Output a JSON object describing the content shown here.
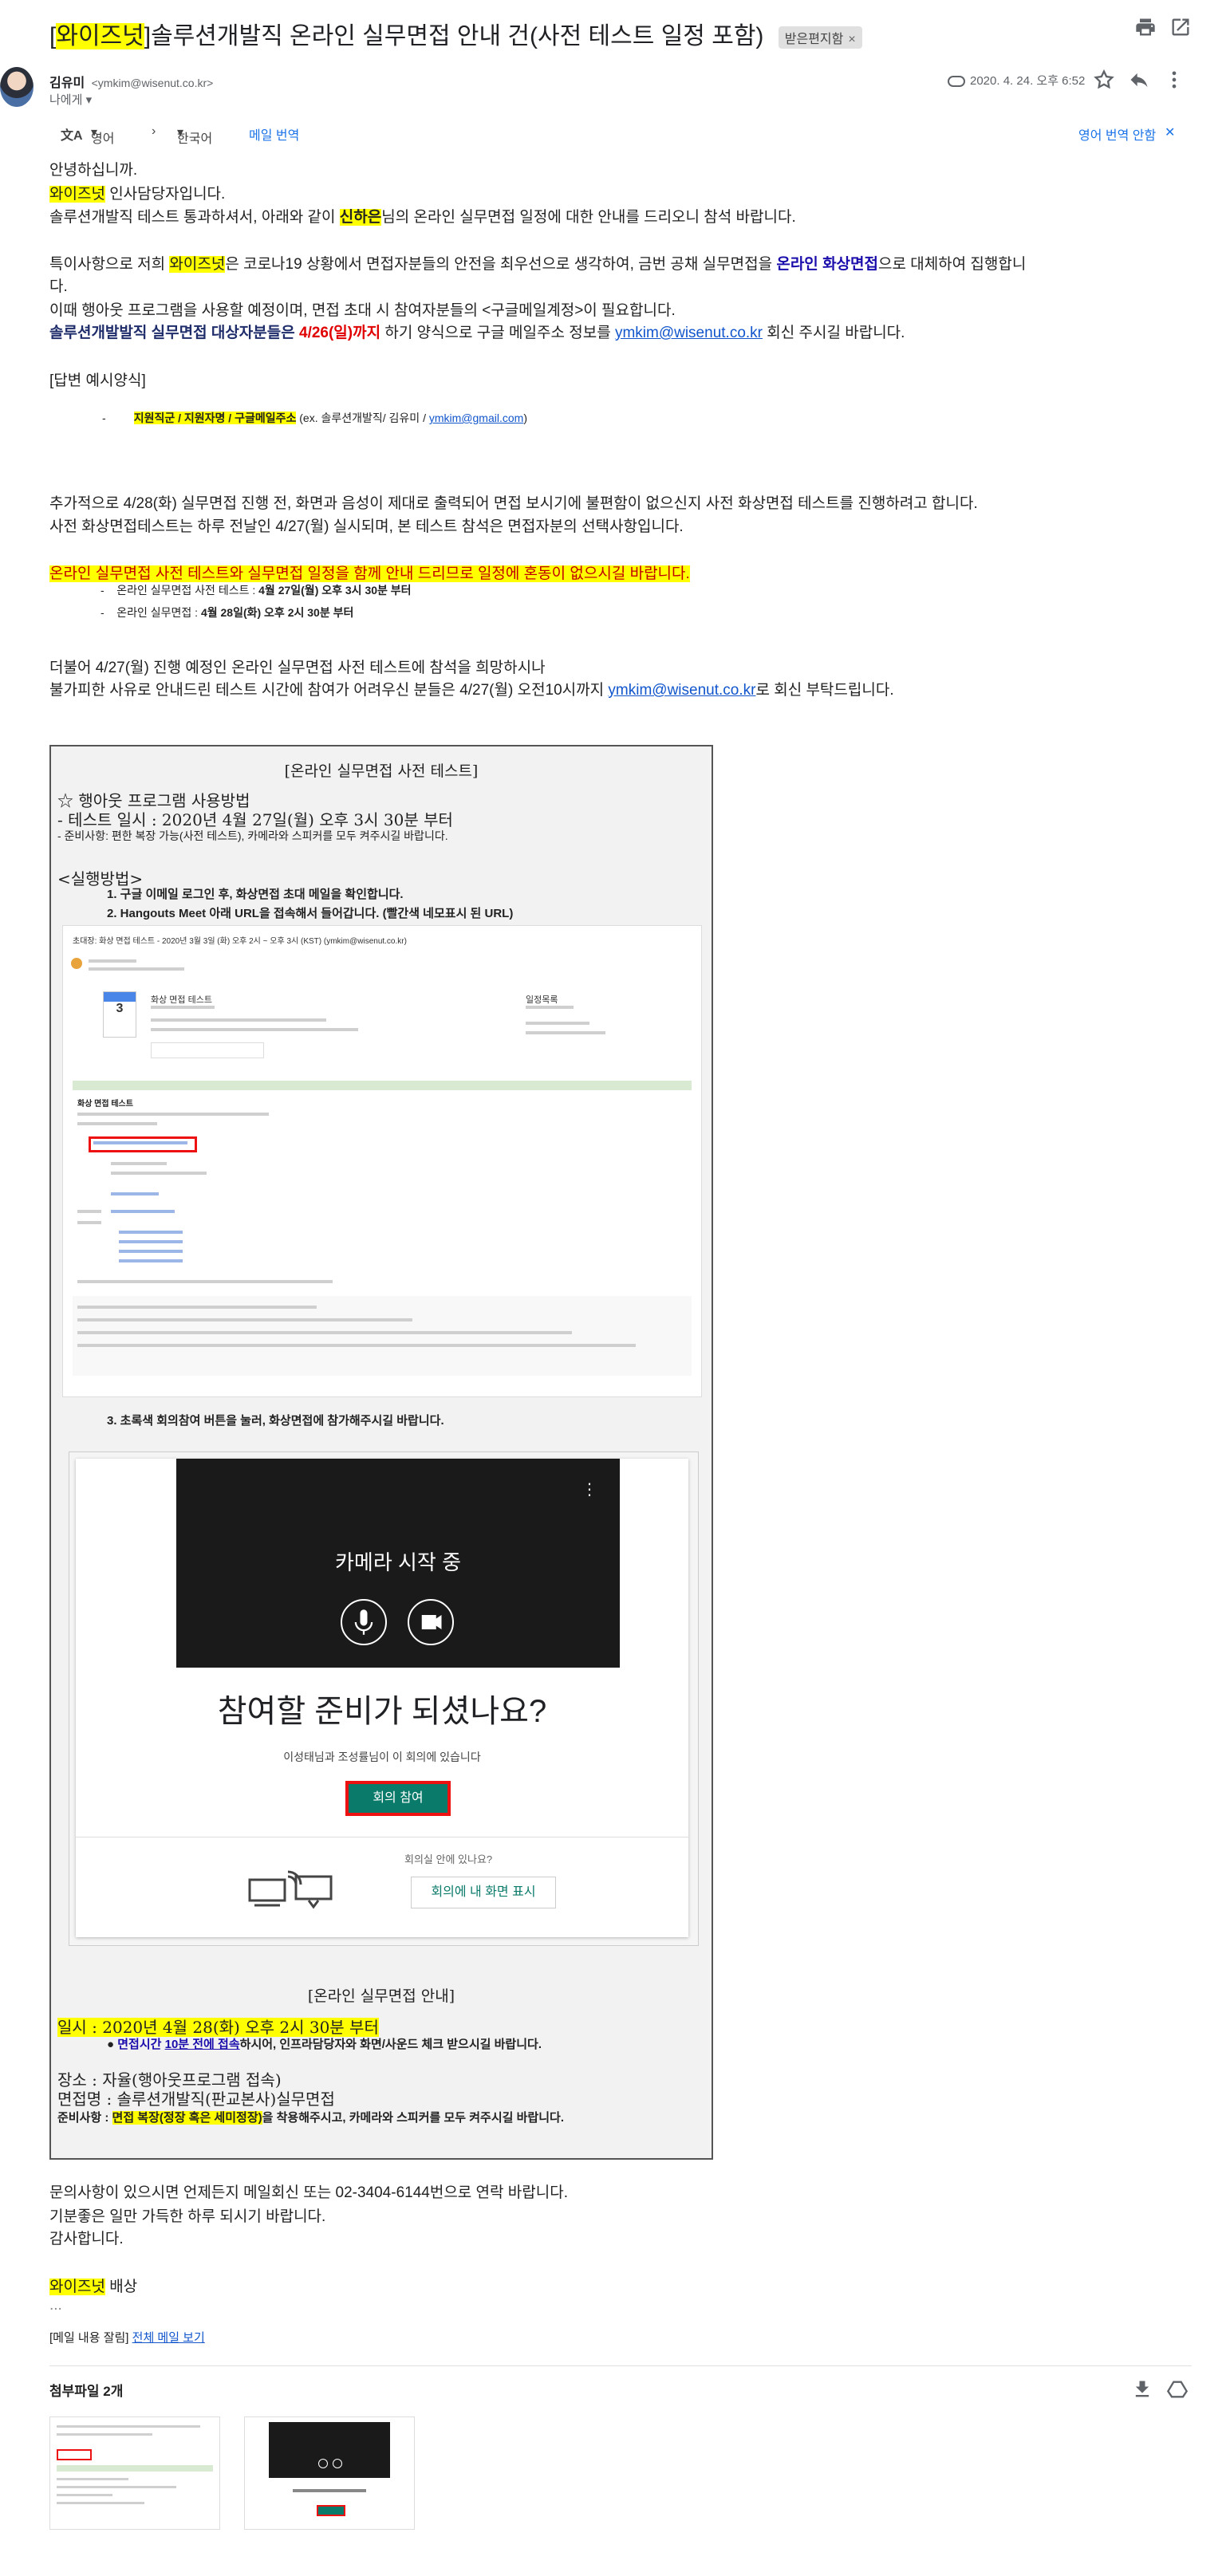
{
  "subject": {
    "brand": "와이즈넛",
    "text": "솔루션개발직 온라인 실무면접 안내 건(사전 테스트 일정 포함)",
    "badge": "받은편지함"
  },
  "sender": {
    "name": "김유미",
    "email": "<ymkim@wisenut.co.kr>",
    "to": "나에게",
    "date": "2020. 4. 24. 오후 6:52"
  },
  "translate": {
    "from": "영어",
    "to": "한국어",
    "action": "메일 번역",
    "disable": "영어 번역 안함"
  },
  "body": {
    "greet": "안녕하십니까.",
    "brand": "와이즈넛",
    "hr": " 인사담당자입니다.",
    "p1a": "솔루션개발직 테스트 통과하셔서, 아래와 같이 ",
    "p1name": "신하은",
    "p1b": "님의 온라인 실무면접 일정에 대한 안내를 드리오니 참석 바랍니다.",
    "p2a": "특이사항으로 저희 ",
    "p2brand": "와이즈넛",
    "p2b": "은 코로나19 상황에서 면접자분들의 안전을 최우선으로 생각하여, 금번 공채 실무면접을 ",
    "p2c": "온라인 화상면접",
    "p2d": "으로 대체하여 집행합니",
    "p2e": "다.",
    "p3": "이때 행아웃 프로그램을 사용할 예정이며, 면접 초대 시 참여자분들의 <구글메일계정>이 필요합니다.",
    "p4a": "솔루션개발발직 실무면접 대상자분들은 ",
    "p4b": "4/26(일)까지",
    "p4c": " 하기 양식으로 구글 메일주소 정보를 ",
    "p4link": "ymkim@wisenut.co.kr",
    "p4d": " 회신 주시길 바랍니다.",
    "form_title": "[답변 예시양식]",
    "form_dash": "-",
    "form_hl": "지원직군 / 지원자명 / 구글메일주소",
    "form_ex": " (ex. 솔루션개발직/ 김유미 / ",
    "form_link": "ymkim@gmail.com",
    "form_end": ")",
    "p5": "추가적으로 4/28(화) 실무면접 진행 전, 화면과 음성이 제대로 출력되어 면접 보시기에 불편함이 없으신지 사전 화상면접 테스트를 진행하려고 합니다.",
    "p6": "사전 화상면접테스트는 하루 전날인 4/27(월) 실시되며, 본 테스트 참석은 면접자분의 선택사항입니다.",
    "p7": "온라인 실무면접 사전 테스트와 실무면접 일정을 함께 안내 드리므로 일정에 혼동이 없으시길 바랍니다.",
    "b1a": "온라인 실무면접 사전 테스트 : ",
    "b1b": "4월 27일(월) 오후 3시 30분 부터",
    "b2a": "온라인 실무면접 : ",
    "b2b": "4월 28일(화) 오후 2시 30분 부터",
    "p8": "더불어 4/27(월) 진행 예정인 온라인 실무면접 사전 테스트에 참석을 희망하시나",
    "p9a": "불가피한 사유로 안내드린 테스트 시간에 참여가 어려우신 분들은 4/27(월) 오전10시까지 ",
    "p9link": "ymkim@wisenut.co.kr",
    "p9b": "로 회신 부탁드립니다."
  },
  "box": {
    "title1": "[온라인 실무면접 사전 테스트]",
    "hangout": "☆ 행아웃 프로그램 사용방법",
    "test_date": "- 테스트 일시 : 2020년 4월 27일(월) 오후 3시 30분 부터",
    "prep": "- 준비사항: 편한 복장 가능(사전 테스트), 카메라와 스피커를 모두 켜주시길 바랍니다.",
    "method": "<실행방법>",
    "step1": "1.  구글 이메일 로그인 후, 화상면접 초대 메일을 확인합니다.",
    "step2": "2.  Hangouts Meet 아래 URL을 접속해서 들어갑니다. (빨간색 네모표시 된 URL)",
    "step3": "3.  초록색 회의참여 버튼을 눌러, 화상면접에 참가해주시길 바랍니다.",
    "shot1_title": "초대장: 화상 면접 테스트 - 2020년 3월 3일 (화) 오후 2시 ~ 오후 3시 (KST) (ymkim@wisenut.co.kr)",
    "shot1_event": "화상 면접 테스트",
    "shot1_date": "3",
    "shot1_section": "화상 면접 테스트",
    "shot1_right": "일정목록",
    "cam": "카메라 시작 중",
    "ready": "참여할 준비가 되셨나요?",
    "in_meeting": "이성태님과 조성률님이 이 회의에 있습니다",
    "join": "회의 참여",
    "room_q": "회의실 안에 있나요?",
    "present": "회의에 내 화면 표시",
    "title2": "[온라인 실무면접 안내]",
    "iv_date": "일시 : 2020년 4월 28(화) 오후 2시 30분 부터",
    "iv_note_a": "면접시간 ",
    "iv_note_b": "10분 전에 접속",
    "iv_note_c": "하시어, 인프라담당자와 화면/사운드 체크 받으시길 바랍니다.",
    "place": "장소 : 자율(행아웃프로그램 접속)",
    "iv_name": "면접명 : 솔루션개발직(판교본사)실무면접",
    "prep2a": "준비사항 : ",
    "prep2b": "면접 복장(정장 혹은 세미정장)",
    "prep2c": "을 착용해주시고, 카메라와 스피커를 모두 켜주시길 바랍니다."
  },
  "closing": {
    "c1": "문의사항이 있으시면 언제든지 메일회신 또는 02-3404-6144번으로 연락 바랍니다.",
    "c2": "기분좋은 일만 가득한 하루 되시기 바랍니다.",
    "c3": "감사합니다.",
    "brand": "와이즈넛",
    "sig": " 배상",
    "ellipsis": "...",
    "clipped": "[메일 내용 잘림] ",
    "view_all": "전체 메일 보기"
  },
  "attachments": {
    "title": "첨부파일 2개"
  },
  "colors": {
    "highlight": "#ffff00",
    "link": "#1155cc",
    "red": "#e00000",
    "meet_green": "#0a7a6a"
  }
}
